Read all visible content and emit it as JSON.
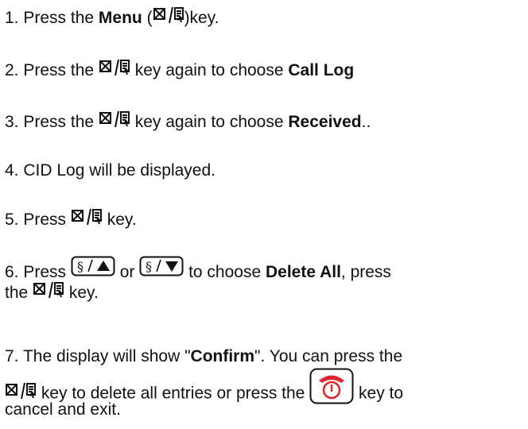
{
  "icons": {
    "menu_key": "menu-softkey-icon",
    "up_key": "phonebook-up-key-icon",
    "down_key": "phonebook-down-key-icon",
    "end_key": "end-call-key-icon",
    "end_key_color": "#e3262c"
  },
  "steps": {
    "s1": {
      "num": "1.",
      "a": "Press the ",
      "bold": "Menu",
      "b": " (",
      "c": ")key."
    },
    "s2": {
      "num": "2.",
      "a": "Press the ",
      "b": " key again to choose ",
      "bold": "Call Log"
    },
    "s3": {
      "num": "3.",
      "a": "Press the ",
      "b": " key again to choose ",
      "bold": "Received",
      "c": ".."
    },
    "s4": {
      "num": "4.",
      "a": "CID Log will be displayed."
    },
    "s5": {
      "num": "5.",
      "a": "Press ",
      "b": " key."
    },
    "s6": {
      "num": "6.",
      "a": "Press ",
      "or": "or",
      "b": " to choose ",
      "bold": "Delete All",
      "c": ", press",
      "line2a": "the ",
      "line2b": " key."
    },
    "s7": {
      "num": "7.",
      "a": "The display will show \"",
      "bold": "Confirm",
      "b": "\". You can press the",
      "line2a": " key to delete all entries or press the ",
      "line2b": " key to",
      "line3": "cancel and exit."
    }
  }
}
